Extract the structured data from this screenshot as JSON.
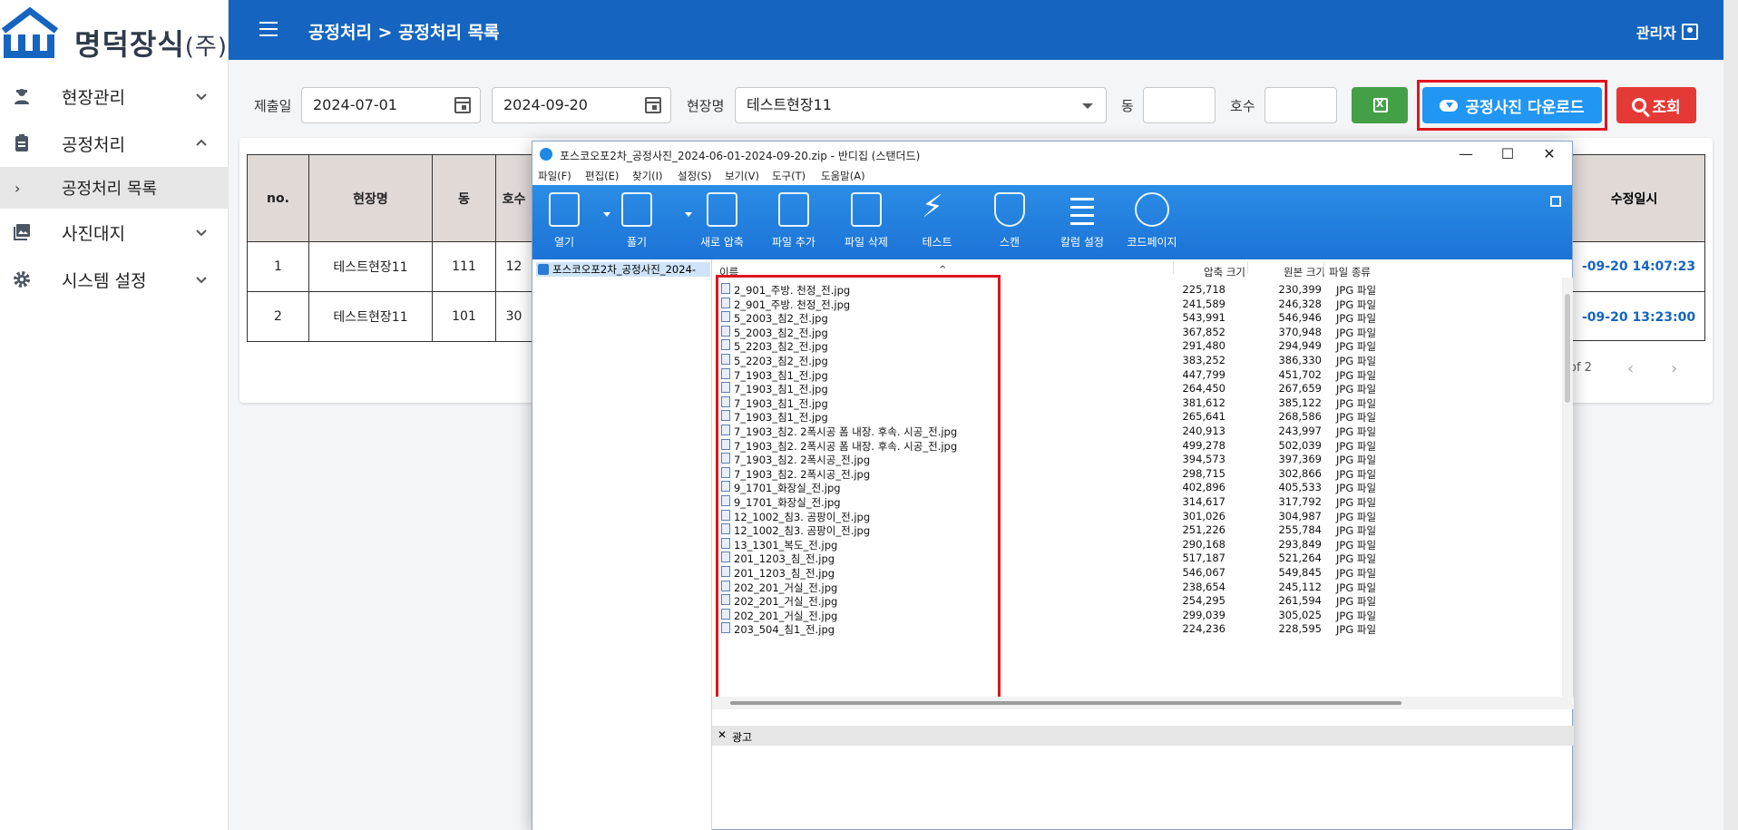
{
  "app": {
    "logo_text": "명덕장식",
    "logo_suffix": "(주)"
  },
  "sidebar": {
    "items": [
      {
        "label": "현장관리",
        "icon": "person-hardhat-icon",
        "expanded": false
      },
      {
        "label": "공정처리",
        "icon": "clipboard-icon",
        "expanded": true
      },
      {
        "label": "사진대지",
        "icon": "photo-library-icon",
        "expanded": false
      },
      {
        "label": "시스템 설정",
        "icon": "gear-icon",
        "expanded": false
      }
    ],
    "sub_items": [
      {
        "label": "공정처리 목록",
        "selected": true
      }
    ]
  },
  "header": {
    "breadcrumb": "공정처리 > 공정처리 목록",
    "user_label": "관리자",
    "color": "#1565c0"
  },
  "filters": {
    "submit_date_label": "제출일",
    "start_date": "2024-07-01",
    "end_date": "2024-09-20",
    "site_label": "현장명",
    "site_value": "테스트현장11",
    "dong_label": "동",
    "dong_value": "",
    "unit_label": "호수",
    "unit_value": "",
    "download_label": "공정사진 다운로드",
    "search_label": "조회"
  },
  "table": {
    "headers": [
      "no.",
      "현장명",
      "동",
      "호수"
    ],
    "last_header": "수정일시",
    "rows": [
      {
        "no": "1",
        "site": "테스트현장11",
        "dong": "111",
        "unit": "12",
        "updated": "-09-20 14:07:23"
      },
      {
        "no": "2",
        "site": "테스트현장11",
        "dong": "101",
        "unit": "30",
        "updated": "-09-20 13:23:00"
      }
    ],
    "pager_text": "of 2"
  },
  "dialog": {
    "title": "포스코오포2차_공정사진_2024-06-01-2024-09-20.zip - 반디집 (스탠더드)",
    "menu": [
      "파일(F)",
      "편집(E)",
      "찾기(I)",
      "설정(S)",
      "보기(V)",
      "도구(T)",
      "도움말(A)"
    ],
    "toolbar": [
      "열기",
      "풀기",
      "새로 압축",
      "파일 추가",
      "파일 삭제",
      "테스트",
      "스캔",
      "칼럼 설정",
      "코드페이지"
    ],
    "tree_item": "포스코오포2차_공정사진_2024-",
    "columns": [
      "이름",
      "압축 크기",
      "원본 크기",
      "파일 종류"
    ],
    "files": [
      {
        "name": "2_901_주방. 천정_전.jpg",
        "packed": "225,718",
        "original": "230,399",
        "type": "JPG 파일"
      },
      {
        "name": "2_901_주방. 천정_전.jpg",
        "packed": "241,589",
        "original": "246,328",
        "type": "JPG 파일"
      },
      {
        "name": "5_2003_침2_전.jpg",
        "packed": "543,991",
        "original": "546,946",
        "type": "JPG 파일"
      },
      {
        "name": "5_2003_침2_전.jpg",
        "packed": "367,852",
        "original": "370,948",
        "type": "JPG 파일"
      },
      {
        "name": "5_2203_침2_전.jpg",
        "packed": "291,480",
        "original": "294,949",
        "type": "JPG 파일"
      },
      {
        "name": "5_2203_침2_전.jpg",
        "packed": "383,252",
        "original": "386,330",
        "type": "JPG 파일"
      },
      {
        "name": "7_1903_침1_전.jpg",
        "packed": "447,799",
        "original": "451,702",
        "type": "JPG 파일"
      },
      {
        "name": "7_1903_침1_전.jpg",
        "packed": "264,450",
        "original": "267,659",
        "type": "JPG 파일"
      },
      {
        "name": "7_1903_침1_전.jpg",
        "packed": "381,612",
        "original": "385,122",
        "type": "JPG 파일"
      },
      {
        "name": "7_1903_침1_전.jpg",
        "packed": "265,641",
        "original": "268,586",
        "type": "JPG 파일"
      },
      {
        "name": "7_1903_침2. 2폭시공 폼 내장. 후속. 시공_전.jpg",
        "packed": "240,913",
        "original": "243,997",
        "type": "JPG 파일"
      },
      {
        "name": "7_1903_침2. 2폭시공 폼 내장. 후속. 시공_전.jpg",
        "packed": "499,278",
        "original": "502,039",
        "type": "JPG 파일"
      },
      {
        "name": "7_1903_침2. 2폭시공_전.jpg",
        "packed": "394,573",
        "original": "397,369",
        "type": "JPG 파일"
      },
      {
        "name": "7_1903_침2. 2폭시공_전.jpg",
        "packed": "298,715",
        "original": "302,866",
        "type": "JPG 파일"
      },
      {
        "name": "9_1701_화장실_전.jpg",
        "packed": "402,896",
        "original": "405,533",
        "type": "JPG 파일"
      },
      {
        "name": "9_1701_화장실_전.jpg",
        "packed": "314,617",
        "original": "317,792",
        "type": "JPG 파일"
      },
      {
        "name": "12_1002_침3. 곰팡이_전.jpg",
        "packed": "301,026",
        "original": "304,987",
        "type": "JPG 파일"
      },
      {
        "name": "12_1002_침3. 곰팡이_전.jpg",
        "packed": "251,226",
        "original": "255,784",
        "type": "JPG 파일"
      },
      {
        "name": "13_1301_복도_전.jpg",
        "packed": "290,168",
        "original": "293,849",
        "type": "JPG 파일"
      },
      {
        "name": "201_1203_침_전.jpg",
        "packed": "517,187",
        "original": "521,264",
        "type": "JPG 파일"
      },
      {
        "name": "201_1203_침_전.jpg",
        "packed": "546,067",
        "original": "549,845",
        "type": "JPG 파일"
      },
      {
        "name": "202_201_거실_전.jpg",
        "packed": "238,654",
        "original": "245,112",
        "type": "JPG 파일"
      },
      {
        "name": "202_201_거실_전.jpg",
        "packed": "254,295",
        "original": "261,594",
        "type": "JPG 파일"
      },
      {
        "name": "202_201_거실_전.jpg",
        "packed": "299,039",
        "original": "305,025",
        "type": "JPG 파일"
      },
      {
        "name": "203_504_침1_전.jpg",
        "packed": "224,236",
        "original": "228,595",
        "type": "JPG 파일"
      }
    ],
    "ad_label": "광고"
  },
  "colors": {
    "accent": "#2196f3",
    "danger": "#e53935",
    "excel": "#43a047",
    "highlight": "#e0141e"
  }
}
